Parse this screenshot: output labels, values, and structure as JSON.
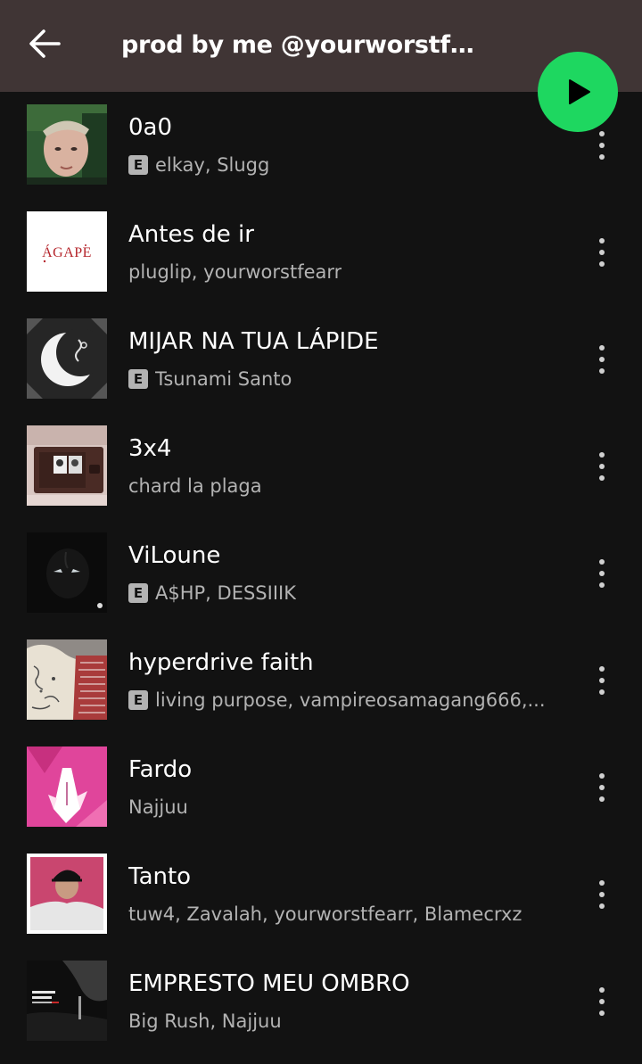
{
  "header": {
    "title": "prod by me @yourworstfe..."
  },
  "icons": {
    "back": "arrow-left-icon",
    "play": "play-icon",
    "more": "more-vertical-icon",
    "explicit": "explicit-icon"
  },
  "colors": {
    "header_bg": "#403535",
    "accent": "#1ed760",
    "background": "#121212",
    "secondary_text": "#b3b3b3"
  },
  "explicit_label": "E",
  "tracks": [
    {
      "title": "0a0",
      "artists": "elkay, Slugg",
      "explicit": true
    },
    {
      "title": "Antes de ir",
      "artists": "pluglip, yourworstfearr",
      "explicit": false,
      "cover_text": "ÁGAPE"
    },
    {
      "title": "MIJAR NA TUA LÁPIDE",
      "artists": "Tsunami Santo",
      "explicit": true
    },
    {
      "title": "3x4",
      "artists": "chard la plaga",
      "explicit": false
    },
    {
      "title": "ViLoune",
      "artists": "A$HP, DESSIIIK",
      "explicit": true
    },
    {
      "title": "hyperdrive faith",
      "artists": "living purpose, vampireosamagang666,...",
      "explicit": true
    },
    {
      "title": "Fardo",
      "artists": "Najjuu",
      "explicit": false
    },
    {
      "title": "Tanto",
      "artists": "tuw4, Zavalah, yourworstfearr, Blamecrxz",
      "explicit": false
    },
    {
      "title": "EMPRESTO MEU OMBRO",
      "artists": "Big Rush, Najjuu",
      "explicit": false
    }
  ]
}
